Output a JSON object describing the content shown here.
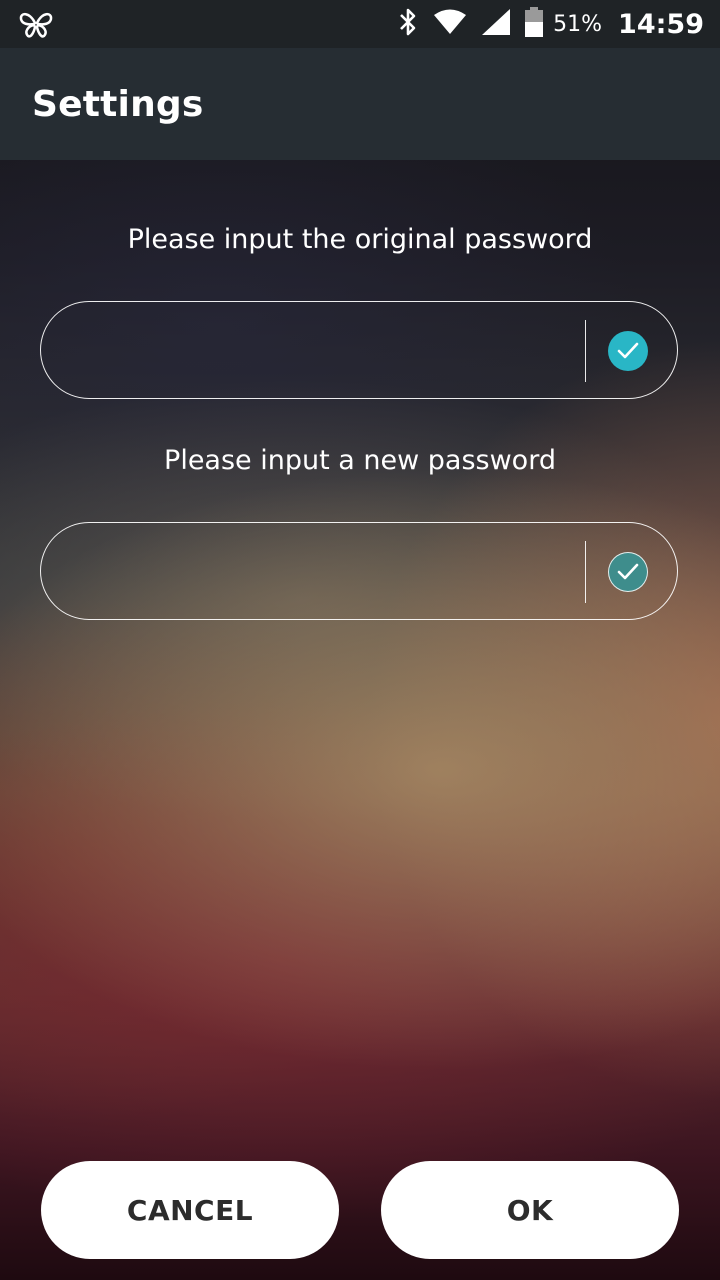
{
  "status_bar": {
    "battery_percent": "51%",
    "time": "14:59",
    "icons": [
      "butterfly-logo-icon",
      "bluetooth-icon",
      "wifi-icon",
      "cell-signal-icon",
      "battery-icon"
    ]
  },
  "app_bar": {
    "title": "Settings"
  },
  "form": {
    "original_password": {
      "prompt": "Please input the original password",
      "value": "",
      "confirm_icon": "check-icon",
      "confirm_color": "#29b6c6"
    },
    "new_password": {
      "prompt": "Please input a new password",
      "value": "",
      "confirm_icon": "check-icon",
      "confirm_color": "#3e8d8c"
    }
  },
  "actions": {
    "cancel_label": "CANCEL",
    "ok_label": "OK"
  }
}
